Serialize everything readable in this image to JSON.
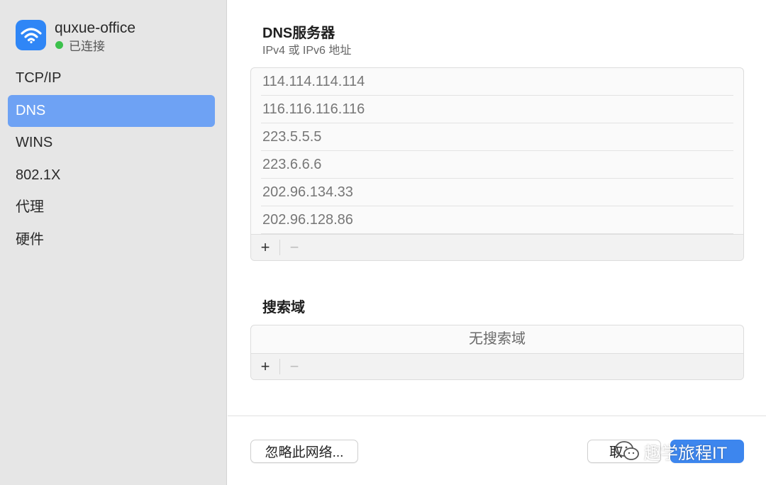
{
  "network": {
    "name": "quxue-office",
    "status": "已连接",
    "status_color": "#3cc14c",
    "icon": "wifi-icon"
  },
  "sidebar": {
    "items": [
      {
        "label": "TCP/IP",
        "active": false
      },
      {
        "label": "DNS",
        "active": true
      },
      {
        "label": "WINS",
        "active": false
      },
      {
        "label": "802.1X",
        "active": false
      },
      {
        "label": "代理",
        "active": false
      },
      {
        "label": "硬件",
        "active": false
      }
    ]
  },
  "dns": {
    "title": "DNS服务器",
    "subtitle": "IPv4 或 IPv6 地址",
    "servers": [
      "114.114.114.114",
      "116.116.116.116",
      "223.5.5.5",
      "223.6.6.6",
      "202.96.134.33",
      "202.96.128.86"
    ],
    "add_label": "+",
    "remove_label": "−"
  },
  "search_domains": {
    "title": "搜索域",
    "empty_text": "无搜索域",
    "add_label": "+",
    "remove_label": "−"
  },
  "footer": {
    "forget_label": "忽略此网络...",
    "cancel_label": "取",
    "ok_label": ""
  },
  "watermark": {
    "text": "趣学旅程IT"
  },
  "colors": {
    "accent": "#3d86ee",
    "sidebar_selected": "#6ea2f4",
    "sidebar_bg": "#e6e6e6"
  }
}
